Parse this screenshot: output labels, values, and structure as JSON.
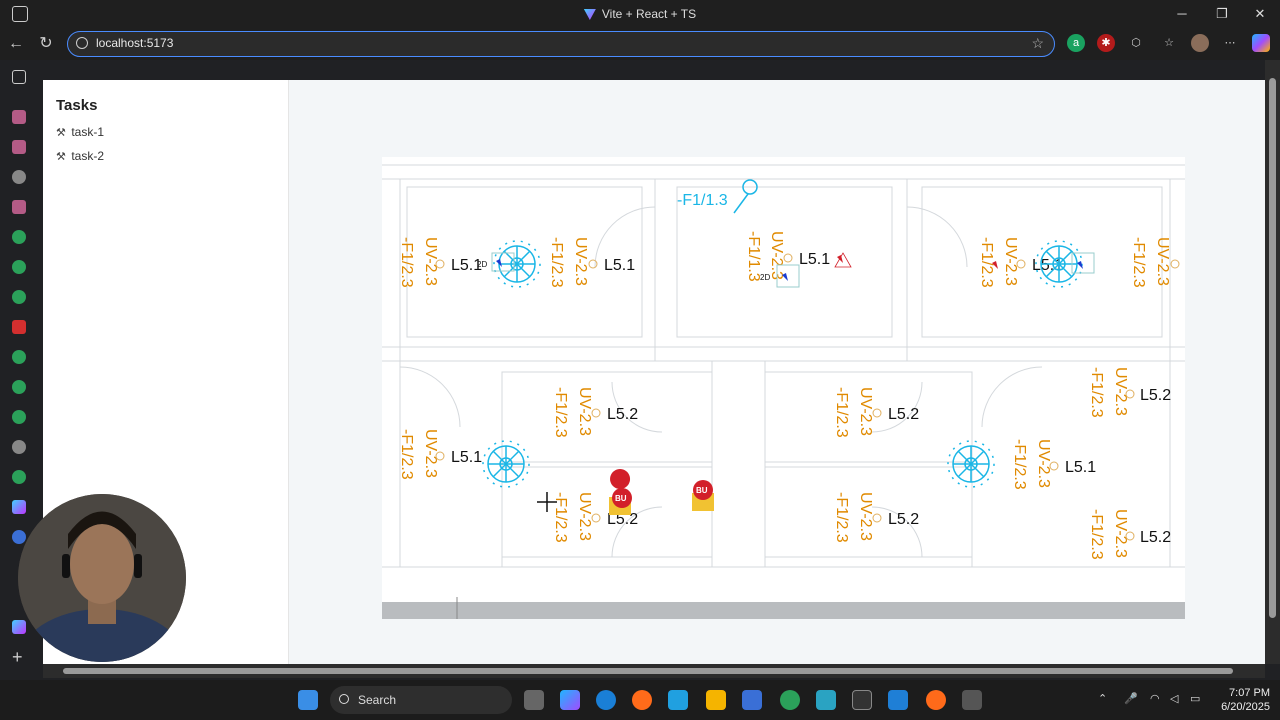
{
  "browser": {
    "window_title": "Vite + React + TS",
    "url": "localhost:5173"
  },
  "sidebar": {
    "title": "Tasks",
    "tasks": [
      {
        "icon": "hammer-wrench-icon",
        "label": "task-1"
      },
      {
        "icon": "hammer-wrench-icon",
        "label": "task-2"
      }
    ]
  },
  "floorplan": {
    "labels_orange": [
      "-F1/2.3",
      "UV-2.3",
      "-F1/1.3",
      "UV-2.3"
    ],
    "labels_black": [
      "L5.1",
      "L5.2"
    ],
    "cyan_label": "-F1/1.3",
    "marker_text": "BU",
    "small_text": "2D"
  },
  "taskbar": {
    "search_placeholder": "Search",
    "time": "7:07 PM",
    "date": "6/20/2025"
  },
  "colors": {
    "orange": "#e08a00",
    "cyan": "#1ab6e6",
    "marker_red": "#d2202a",
    "accent_blue": "#4a8cff"
  }
}
